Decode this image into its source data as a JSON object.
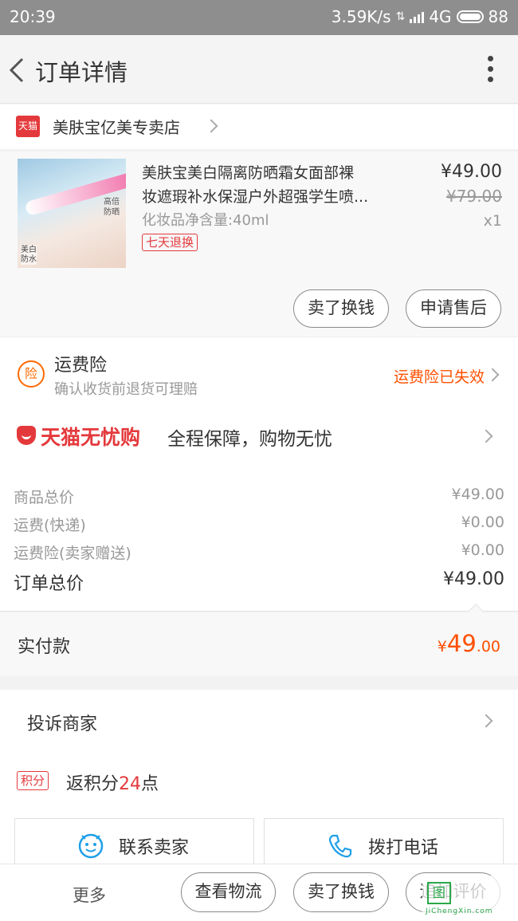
{
  "status_bar": {
    "time": "20:39",
    "speed": "3.59K/s",
    "network": "4G",
    "battery": "88"
  },
  "header": {
    "title": "订单详情"
  },
  "store": {
    "logo_text": "天猫",
    "name": "美肤宝亿美专卖店"
  },
  "product": {
    "title_line1": "美肤宝美白隔离防晒霜女面部裸",
    "title_line2": "妆遮瑕补水保湿户外超强学生喷...",
    "spec": "化妆品净含量:40ml",
    "return_badge": "七天退换",
    "price": "¥49.00",
    "original_price": "¥79.00",
    "quantity": "x1",
    "image_text_1": "高倍\n防晒",
    "image_text_2": "美白\n防水",
    "sell_button": "卖了换钱",
    "after_sale_button": "申请售后"
  },
  "insurance": {
    "icon_text": "险",
    "title": "运费险",
    "subtitle": "确认收货前退货可理赔",
    "status": "运费险已失效"
  },
  "guarantee": {
    "brand": "天猫无忧购",
    "text": "全程保障，购物无忧"
  },
  "summary": {
    "rows": [
      {
        "label": "商品总价",
        "value": "¥49.00"
      },
      {
        "label": "运费(快递)",
        "value": "¥0.00"
      },
      {
        "label": "运费险(卖家赠送)",
        "value": "¥0.00"
      }
    ],
    "total_label": "订单总价",
    "total_value": "¥49.00"
  },
  "paid": {
    "label": "实付款",
    "currency": "¥",
    "amount_int": "49",
    "amount_dec": ".00"
  },
  "complaint": {
    "label": "投诉商家"
  },
  "points": {
    "badge": "积分",
    "prefix": "返积分",
    "value": "24",
    "suffix": "点"
  },
  "contact": {
    "seller_label": "联系卖家",
    "phone_label": "拨打电话"
  },
  "bottom_bar": {
    "more": "更多",
    "logistics": "查看物流",
    "sell": "卖了换钱",
    "review": "追加评价"
  },
  "watermark": {
    "mark": "图",
    "site": "JiChengXin.com"
  },
  "colors": {
    "accent": "#ff5000",
    "tmall_red": "#e4393c",
    "contact_blue": "#1e9fe8"
  }
}
